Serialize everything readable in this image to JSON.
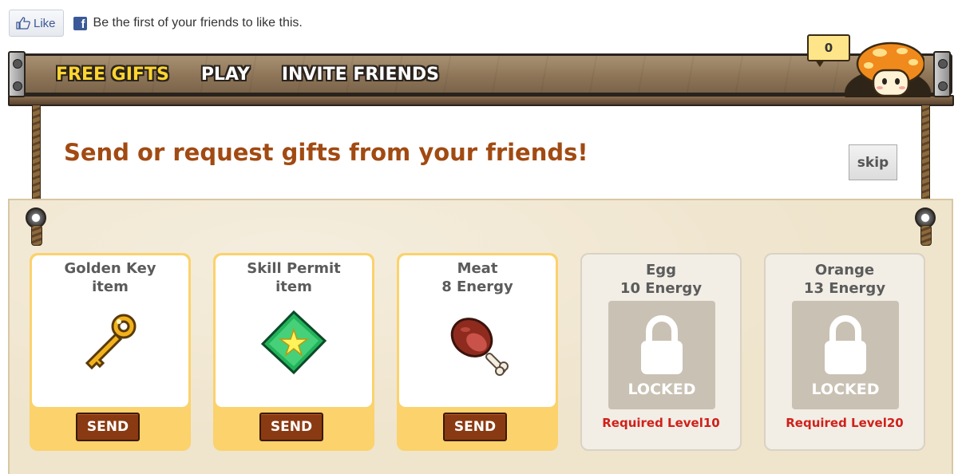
{
  "facebook": {
    "like_label": "Like",
    "friends_text": "Be the first of your friends to like this."
  },
  "nav": {
    "items": [
      {
        "label": "FREE GIFTS",
        "active": true
      },
      {
        "label": "PLAY",
        "active": false
      },
      {
        "label": "INVITE FRIENDS",
        "active": false
      }
    ],
    "mailbox_count": "0"
  },
  "main": {
    "headline": "Send or request gifts from your friends!",
    "skip_label": "skip"
  },
  "gifts": [
    {
      "name": "Golden Key",
      "subtitle": "item",
      "icon": "golden-key-icon",
      "locked": false,
      "action": "SEND"
    },
    {
      "name": "Skill Permit",
      "subtitle": "item",
      "icon": "skill-permit-icon",
      "locked": false,
      "action": "SEND"
    },
    {
      "name": "Meat",
      "subtitle": "8 Energy",
      "icon": "meat-icon",
      "locked": false,
      "action": "SEND"
    },
    {
      "name": "Egg",
      "subtitle": "10 Energy",
      "icon": "lock-icon",
      "locked": true,
      "lock_label": "LOCKED",
      "requirement": "Required Level10"
    },
    {
      "name": "Orange",
      "subtitle": "13 Energy",
      "icon": "lock-icon",
      "locked": true,
      "lock_label": "LOCKED",
      "requirement": "Required Level20"
    }
  ],
  "colors": {
    "headline": "#a14a12",
    "active_nav": "#ffd530",
    "send_button": "#8a3a12",
    "requirement": "#d0201a",
    "card_unlocked": "#fbd26c"
  }
}
